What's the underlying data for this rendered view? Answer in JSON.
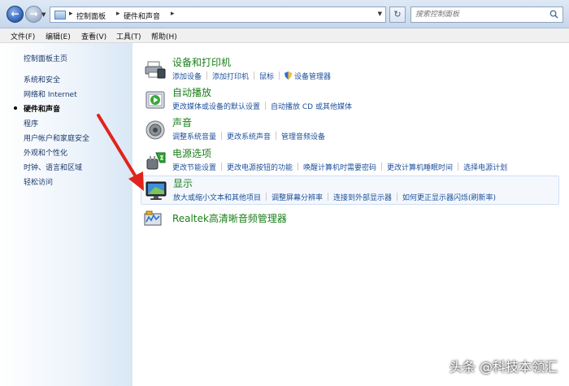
{
  "address_bar": {
    "crumbs": [
      "控制面板",
      "硬件和声音"
    ],
    "search_placeholder": "搜索控制面板"
  },
  "menu": [
    "文件(F)",
    "编辑(E)",
    "查看(V)",
    "工具(T)",
    "帮助(H)"
  ],
  "sidebar": {
    "home": "控制面板主页",
    "items": [
      {
        "label": "系统和安全",
        "active": false
      },
      {
        "label": "网络和 Internet",
        "active": false
      },
      {
        "label": "硬件和声音",
        "active": true
      },
      {
        "label": "程序",
        "active": false
      },
      {
        "label": "用户帐户和家庭安全",
        "active": false
      },
      {
        "label": "外观和个性化",
        "active": false
      },
      {
        "label": "时钟、语言和区域",
        "active": false
      },
      {
        "label": "轻松访问",
        "active": false
      }
    ]
  },
  "sections": [
    {
      "title": "设备和打印机",
      "icon": "printer-icon",
      "links": [
        "添加设备",
        "添加打印机",
        "鼠标",
        "设备管理器"
      ]
    },
    {
      "title": "自动播放",
      "icon": "autoplay-icon",
      "links": [
        "更改媒体或设备的默认设置",
        "自动播放 CD 或其他媒体"
      ]
    },
    {
      "title": "声音",
      "icon": "speaker-icon",
      "links": [
        "调整系统音量",
        "更改系统声音",
        "管理音频设备"
      ]
    },
    {
      "title": "电源选项",
      "icon": "power-icon",
      "links": [
        "更改节能设置",
        "更改电源按钮的功能",
        "唤醒计算机时需要密码",
        "更改计算机睡眠时间",
        "选择电源计划"
      ]
    },
    {
      "title": "显示",
      "icon": "display-icon",
      "links": [
        "放大或缩小文本和其他项目",
        "调整屏幕分辨率",
        "连接到外部显示器",
        "如何更正显示器闪烁(刷新率)"
      ]
    },
    {
      "title": "Realtek高清晰音频管理器",
      "icon": "realtek-icon",
      "links": []
    }
  ],
  "watermark": "头条 @科技本领汇",
  "colors": {
    "title_green": "#1a7f1a",
    "link_blue": "#1c4f9b",
    "arrow_red": "#e0241b"
  }
}
